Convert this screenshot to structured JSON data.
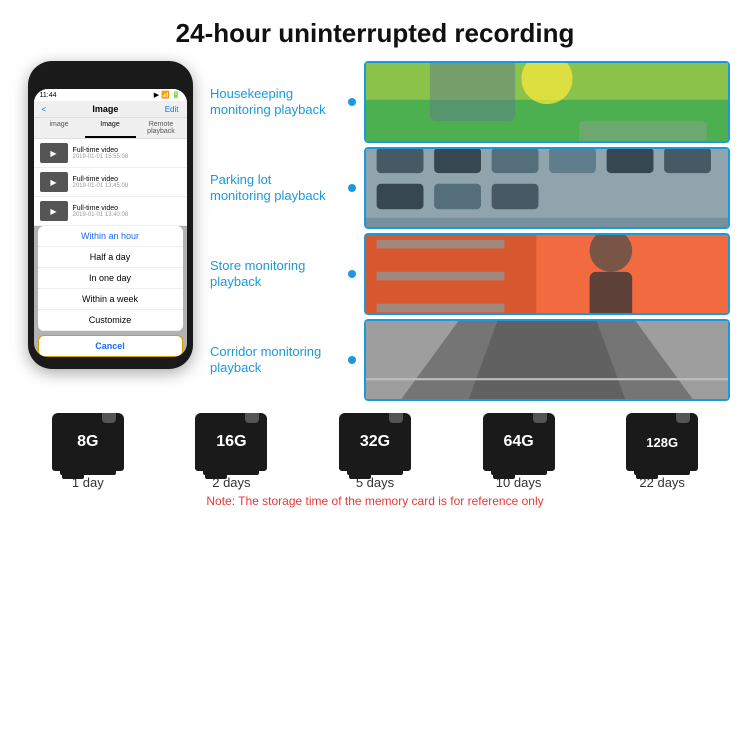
{
  "header": {
    "title": "24-hour uninterrupted recording"
  },
  "phone": {
    "status_time": "11:44",
    "nav_back": "<",
    "nav_title": "Image",
    "nav_edit": "Edit",
    "tabs": [
      "image",
      "Image",
      "Remote playback"
    ],
    "videos": [
      {
        "title": "Full-time video",
        "date": "2019-01-01 15:55:08"
      },
      {
        "title": "Full-time video",
        "date": "2019-01-01 13:45:08"
      },
      {
        "title": "Full-time video",
        "date": "2019-01-01 13:40:08"
      }
    ],
    "dropdown": {
      "items": [
        "Within an hour",
        "Half a day",
        "In one day",
        "Within a week",
        "Customize"
      ],
      "highlighted_index": 0,
      "cancel_label": "Cancel"
    }
  },
  "monitoring": [
    {
      "label": "Housekeeping monitoring playback",
      "scene": "playground"
    },
    {
      "label": "Parking lot monitoring playback",
      "scene": "parking"
    },
    {
      "label": "Store monitoring playback",
      "scene": "store"
    },
    {
      "label": "Corridor monitoring playback",
      "scene": "corridor"
    }
  ],
  "storage": {
    "cards": [
      {
        "size": "8G",
        "days": "1 day"
      },
      {
        "size": "16G",
        "days": "2 days"
      },
      {
        "size": "32G",
        "days": "5 days"
      },
      {
        "size": "64G",
        "days": "10 days"
      },
      {
        "size": "128G",
        "days": "22 days"
      }
    ],
    "note": "Note: The storage time of the memory card is for reference only"
  }
}
